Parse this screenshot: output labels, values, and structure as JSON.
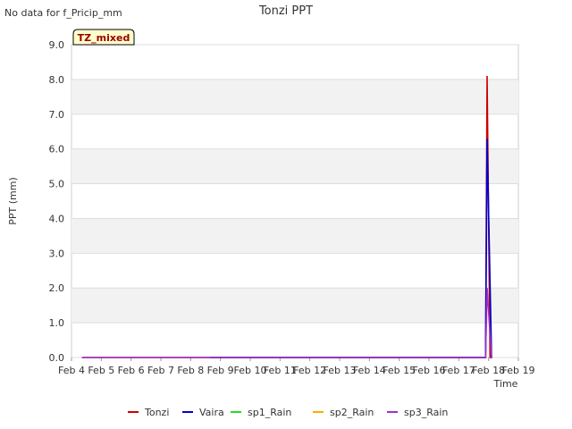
{
  "chart_data": {
    "type": "line",
    "title": "Tonzi PPT",
    "nodata_note": "No data for f_Pricip_mm",
    "badge": "TZ_mixed",
    "xlabel": "Time",
    "ylabel": "PPT (mm)",
    "ylim": [
      0,
      9
    ],
    "yticks": [
      "0.0",
      "1.0",
      "2.0",
      "3.0",
      "4.0",
      "5.0",
      "6.0",
      "7.0",
      "8.0",
      "9.0"
    ],
    "xlim": [
      4,
      19
    ],
    "xticks": [
      "Feb 4",
      "Feb 5",
      "Feb 6",
      "Feb 7",
      "Feb 8",
      "Feb 9",
      "Feb 10",
      "Feb 11",
      "Feb 12",
      "Feb 13",
      "Feb 14",
      "Feb 15",
      "Feb 16",
      "Feb 17",
      "Feb 18",
      "Feb 19"
    ],
    "xtick_days": [
      4,
      5,
      6,
      7,
      8,
      9,
      10,
      11,
      12,
      13,
      14,
      15,
      16,
      17,
      18,
      19
    ],
    "grid": "horizontal bands",
    "legend_position": "bottom",
    "series": [
      {
        "name": "Tonzi",
        "color": "#cc0000",
        "x": [
          4.35,
          17.9,
          17.95,
          18.05,
          18.1
        ],
        "y": [
          0,
          0,
          8.1,
          0,
          0
        ]
      },
      {
        "name": "Vaira",
        "color": "#0000cc",
        "x": [
          8.65,
          17.9,
          17.95,
          18.1,
          18.12
        ],
        "y": [
          0,
          0,
          6.3,
          0,
          0
        ]
      },
      {
        "name": "sp1_Rain",
        "color": "#22dd22",
        "x": [],
        "y": []
      },
      {
        "name": "sp2_Rain",
        "color": "#ffaa00",
        "x": [],
        "y": []
      },
      {
        "name": "sp3_Rain",
        "color": "#9933cc",
        "x": [
          4.35,
          17.9,
          17.95,
          18.1,
          18.12
        ],
        "y": [
          0,
          0,
          2.0,
          0,
          0
        ]
      }
    ]
  }
}
